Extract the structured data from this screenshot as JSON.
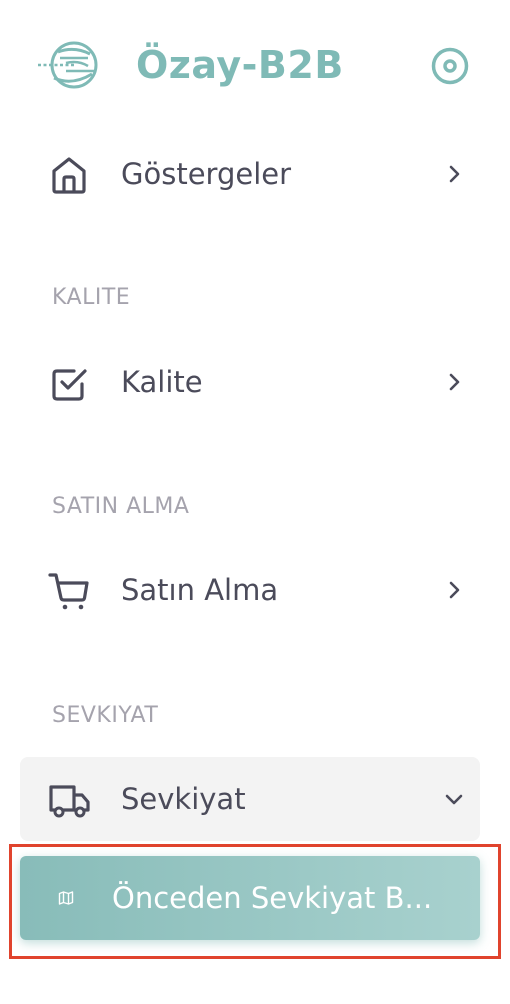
{
  "brand": {
    "title": "Özay-B2B",
    "logo_icon": "globe-logo-icon",
    "toggle_icon": "circle-dot-icon",
    "color": "#7fbab6"
  },
  "menu": {
    "dashboard": {
      "label": "Göstergeler",
      "icon": "home-icon",
      "arrow_icon": "chevron-right-icon"
    },
    "sections": [
      {
        "header": "KALITE",
        "item": {
          "label": "Kalite",
          "icon": "checkbox-icon",
          "arrow_icon": "chevron-right-icon"
        }
      },
      {
        "header": "SATIN ALMA",
        "item": {
          "label": "Satın Alma",
          "icon": "cart-icon",
          "arrow_icon": "chevron-right-icon"
        }
      },
      {
        "header": "SEVKIYAT",
        "item": {
          "label": "Sevkiyat",
          "icon": "truck-icon",
          "arrow_icon": "chevron-down-icon",
          "expanded": true
        }
      }
    ],
    "submenu": [
      {
        "label": "Önceden Sevkiyat B...",
        "icon": "map-icon",
        "active": true
      }
    ]
  },
  "colors": {
    "accent": "#7fbab6",
    "active_gradient_start": "#88bcb9",
    "active_gradient_end": "#a8d1ce",
    "highlight_border": "#e0432d",
    "text": "#4b4b5a",
    "section_header": "#a5a3ad"
  }
}
